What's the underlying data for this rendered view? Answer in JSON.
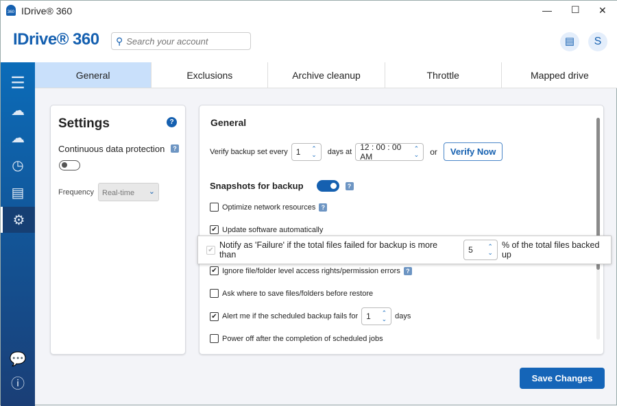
{
  "window": {
    "title": "IDrive® 360",
    "minimize": "—",
    "maximize": "☐",
    "close": "✕"
  },
  "header": {
    "logo": "IDrive® 360",
    "search_placeholder": "Search your account",
    "avatar": "S"
  },
  "tabs": [
    "General",
    "Exclusions",
    "Archive cleanup",
    "Throttle",
    "Mapped drive"
  ],
  "settings": {
    "title": "Settings",
    "cdp_label": "Continuous data protection",
    "cdp_enabled": false,
    "frequency_label": "Frequency",
    "frequency_value": "Real-time"
  },
  "general": {
    "title": "General",
    "verify_prefix": "Verify backup set every",
    "verify_days": "1",
    "days_at": "days at",
    "time": "12 : 00 : 00 AM",
    "or": "or",
    "verify_now": "Verify Now",
    "snapshots_label": "Snapshots for backup",
    "snapshots_enabled": true,
    "options": [
      {
        "label": "Optimize network resources",
        "checked": false
      },
      {
        "label": "Update software automatically",
        "checked": true
      },
      {
        "label": "Ignore file/folder level access rights/permission errors",
        "checked": true
      },
      {
        "label": "Ask where to save files/folders before restore",
        "checked": false
      },
      {
        "label": "Alert me if the scheduled backup fails for",
        "checked": true,
        "value": "1",
        "suffix": "days"
      },
      {
        "label": "Power off after the completion of scheduled jobs",
        "checked": false
      }
    ],
    "notify": {
      "label": "Notify as 'Failure' if the total files failed for backup is more than",
      "value": "5",
      "suffix": "% of the total files backed up",
      "checked": true
    }
  },
  "save_button": "Save Changes"
}
